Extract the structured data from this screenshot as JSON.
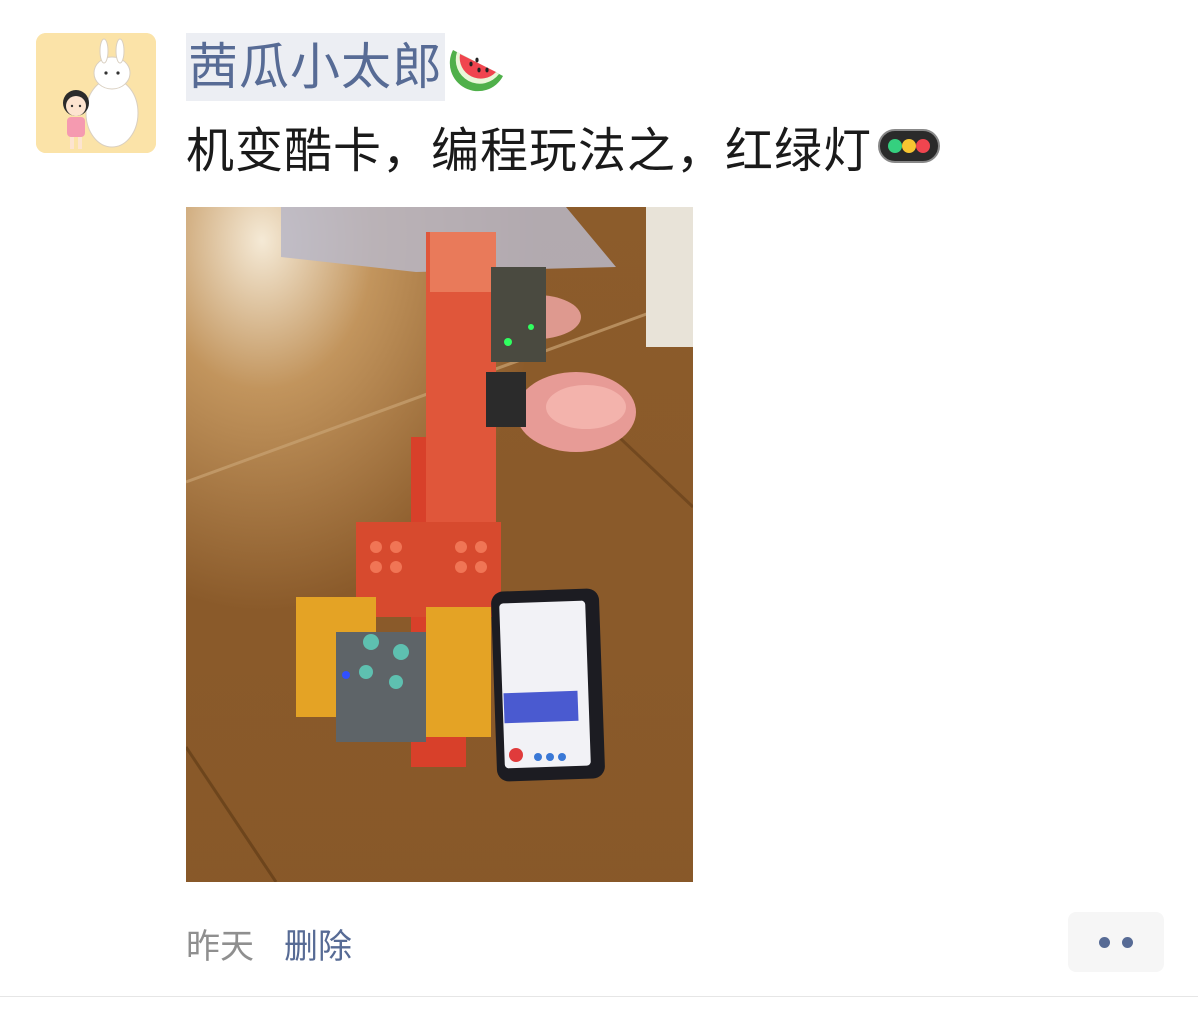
{
  "post": {
    "username": "茜瓜小太郎",
    "username_emoji": "watermelon-emoji",
    "text": "机变酷卡，编程玩法之，红绿灯",
    "text_emoji": "traffic-light-emoji",
    "photo_icon": "robot-traffic-light-photo"
  },
  "footer": {
    "time": "昨天",
    "delete_label": "删除",
    "more_icon": "more-dots-icon"
  },
  "colors": {
    "link": "#576b95",
    "text": "#1a1a1a",
    "meta": "#8f8f8f"
  }
}
